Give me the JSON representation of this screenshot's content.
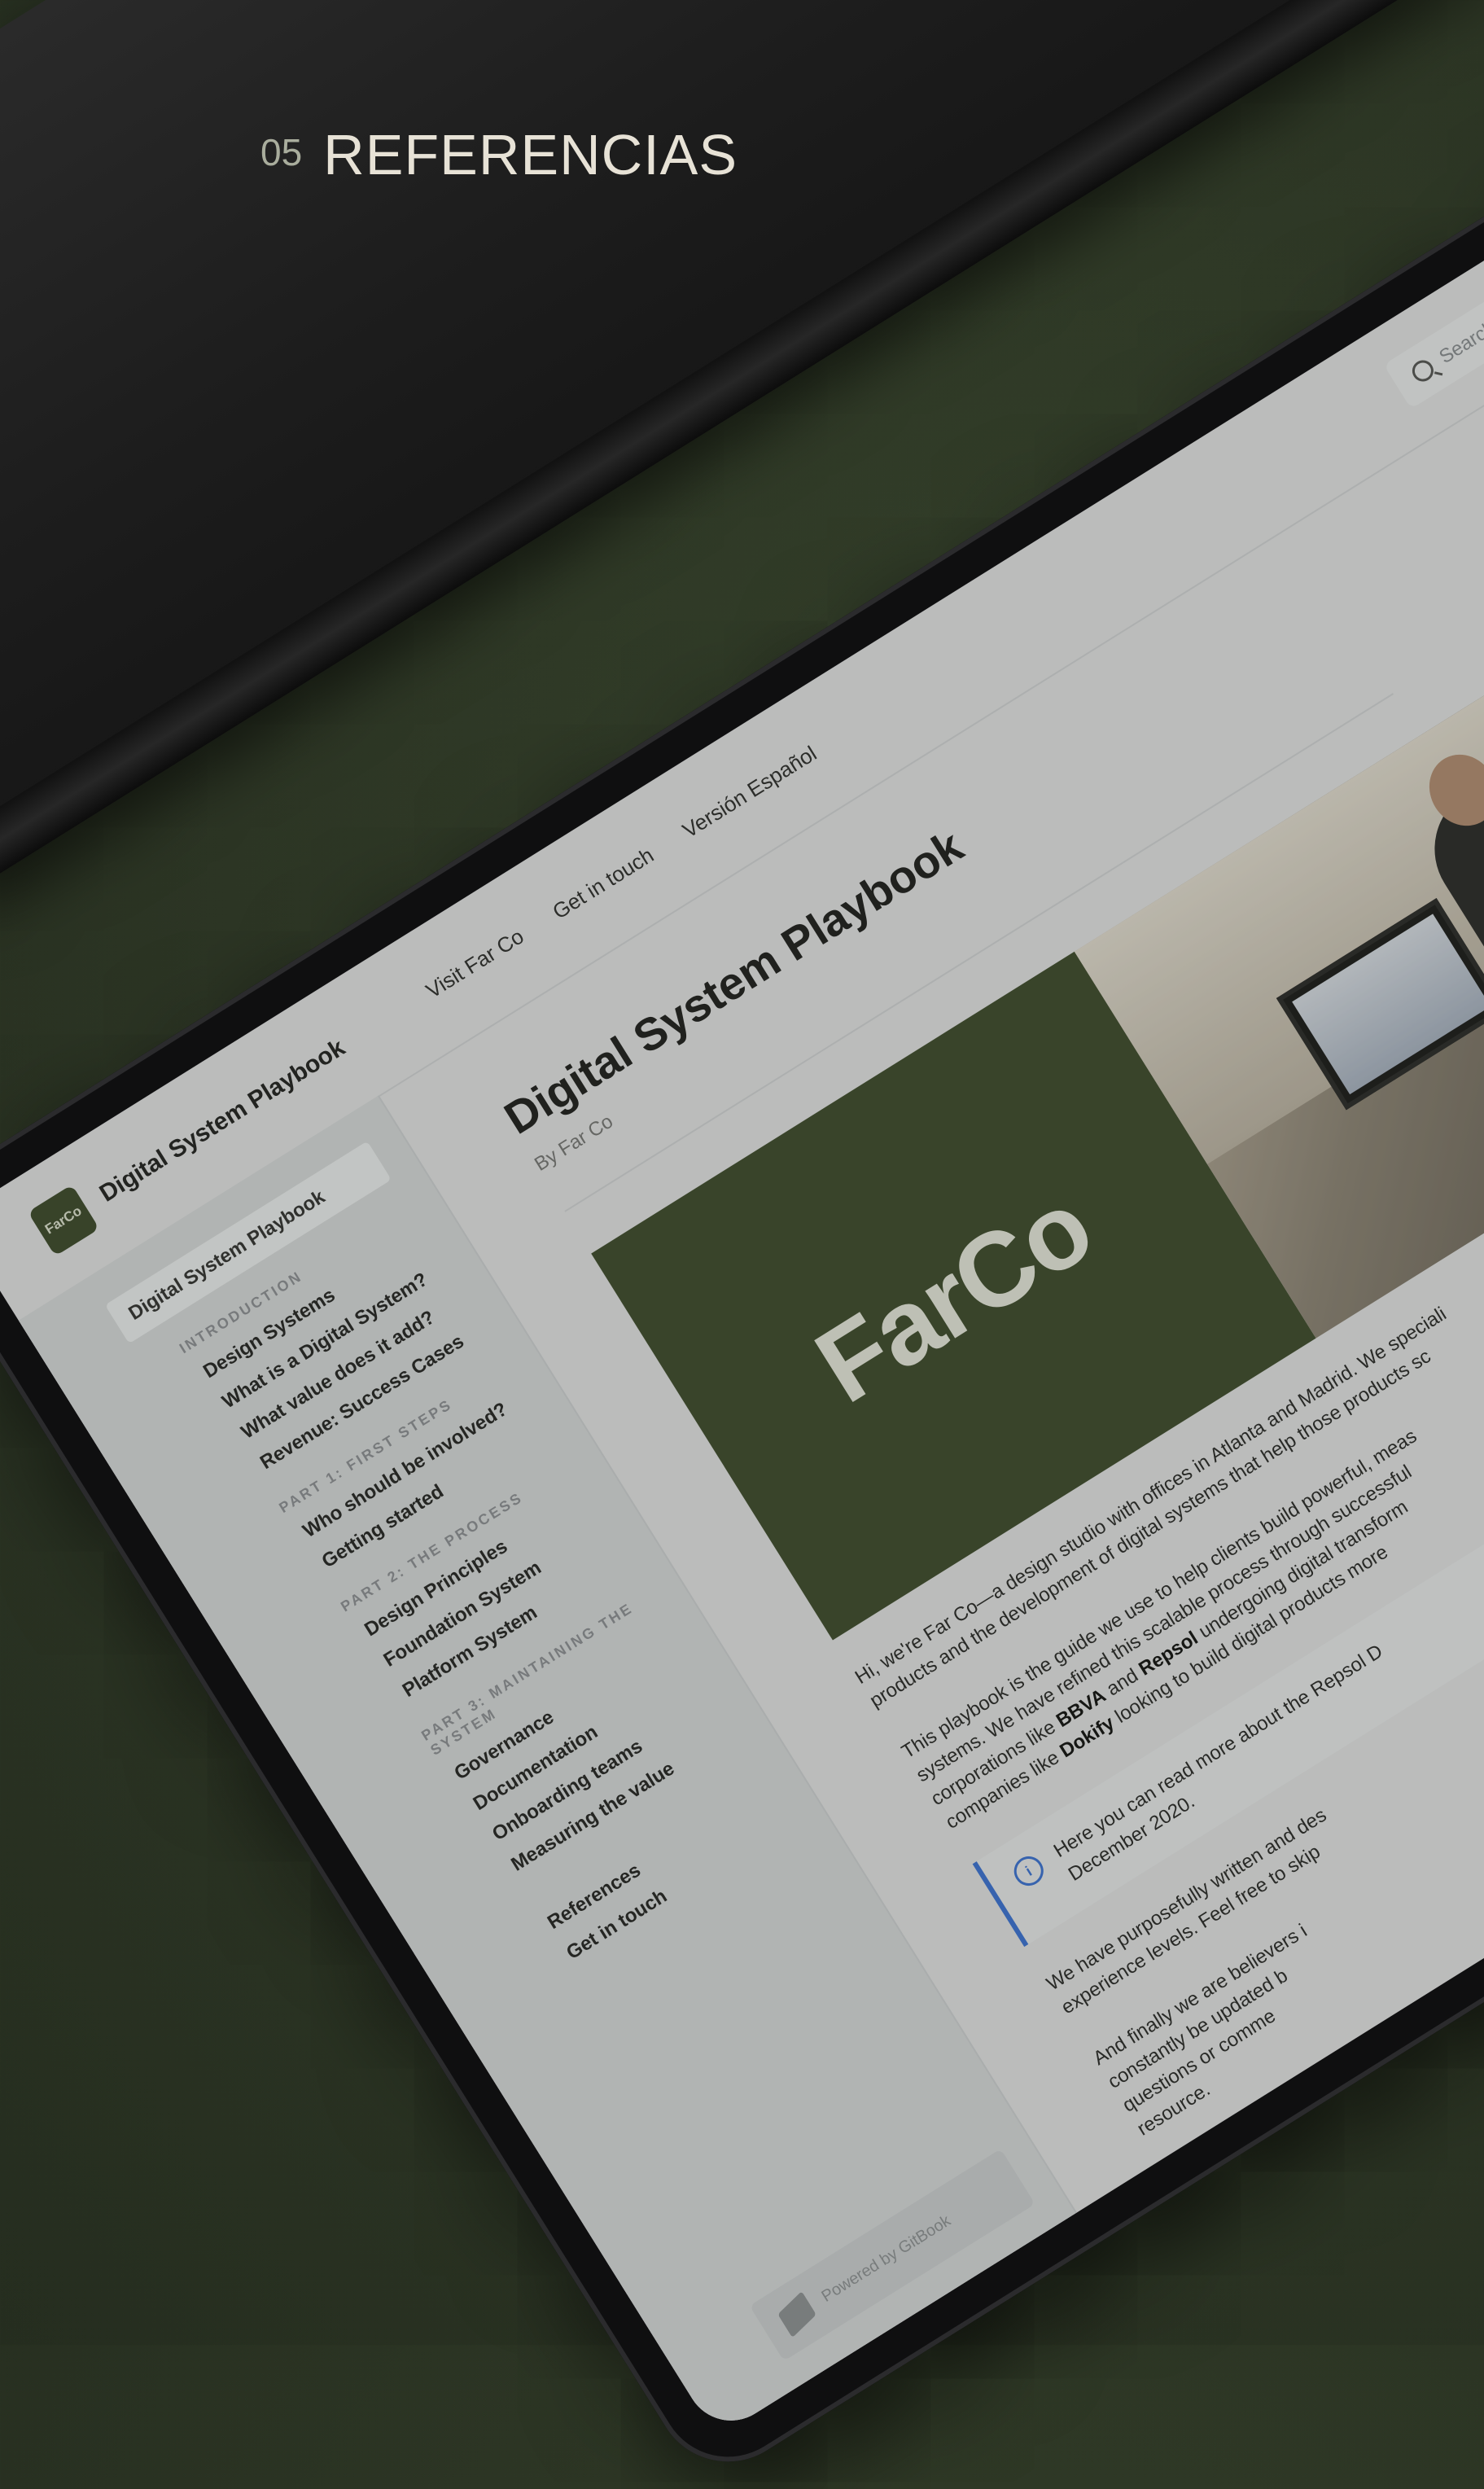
{
  "page_header": {
    "number": "05",
    "title": "REFERENCIAS"
  },
  "app": {
    "logo_text": "FarCo",
    "brand_name": "Digital System Playbook",
    "top_links": [
      "Visit Far Co",
      "Get in touch",
      "Versión Español"
    ],
    "search_placeholder": "Search..."
  },
  "sidebar": {
    "active_item": "Digital System Playbook",
    "sections": [
      {
        "title": "INTRODUCTION",
        "items": [
          "Design Systems",
          "What is a Digital System?",
          "What value does it add?",
          "Revenue: Success Cases"
        ]
      },
      {
        "title": "PART 1: FIRST STEPS",
        "items": [
          "Who should be involved?",
          "Getting started"
        ]
      },
      {
        "title": "PART 2: THE PROCESS",
        "items": [
          "Design Principles",
          "Foundation System",
          "Platform System"
        ]
      },
      {
        "title": "PART 3: MAINTAINING THE SYSTEM",
        "items": [
          "Governance",
          "Documentation",
          "Onboarding teams",
          "Measuring the value"
        ]
      }
    ],
    "extra_items": [
      "References",
      "Get in touch"
    ],
    "powered_by": "Powered by GitBook"
  },
  "main": {
    "title": "Digital System Playbook",
    "byline": "By Far Co",
    "hero_logo": "FarCo",
    "para1": "Hi, we're Far Co—a design studio with offices in Atlanta and Madrid. We speciali",
    "para1b": "products and the development of digital systems that help those products sc",
    "para2a": "This playbook is the guide we use to help clients build powerful, meas",
    "para2b": "systems. We have refined this scalable process through successful",
    "para2c_pre": "corporations like ",
    "bbva": "BBVA",
    "para2c_mid": " and ",
    "repsol": "Repsol",
    "para2c_post": " undergoing digital transform",
    "para2d_pre": "companies like ",
    "dokify": "Dokify",
    "para2d_post": " looking to build digital products more",
    "callout1": "Here you can read more about the Repsol D",
    "callout2": "December 2020.",
    "para3a": "We have purposefully written and des",
    "para3b": "experience levels. Feel free to skip",
    "para4a": "And finally we are believers i",
    "para4b": "constantly be updated b",
    "para4c": "questions or comme",
    "para4d": "resource."
  },
  "colors": {
    "brand_green": "#3e4b2d",
    "accent_blue": "#3b73d6",
    "background": "#2c3524"
  }
}
